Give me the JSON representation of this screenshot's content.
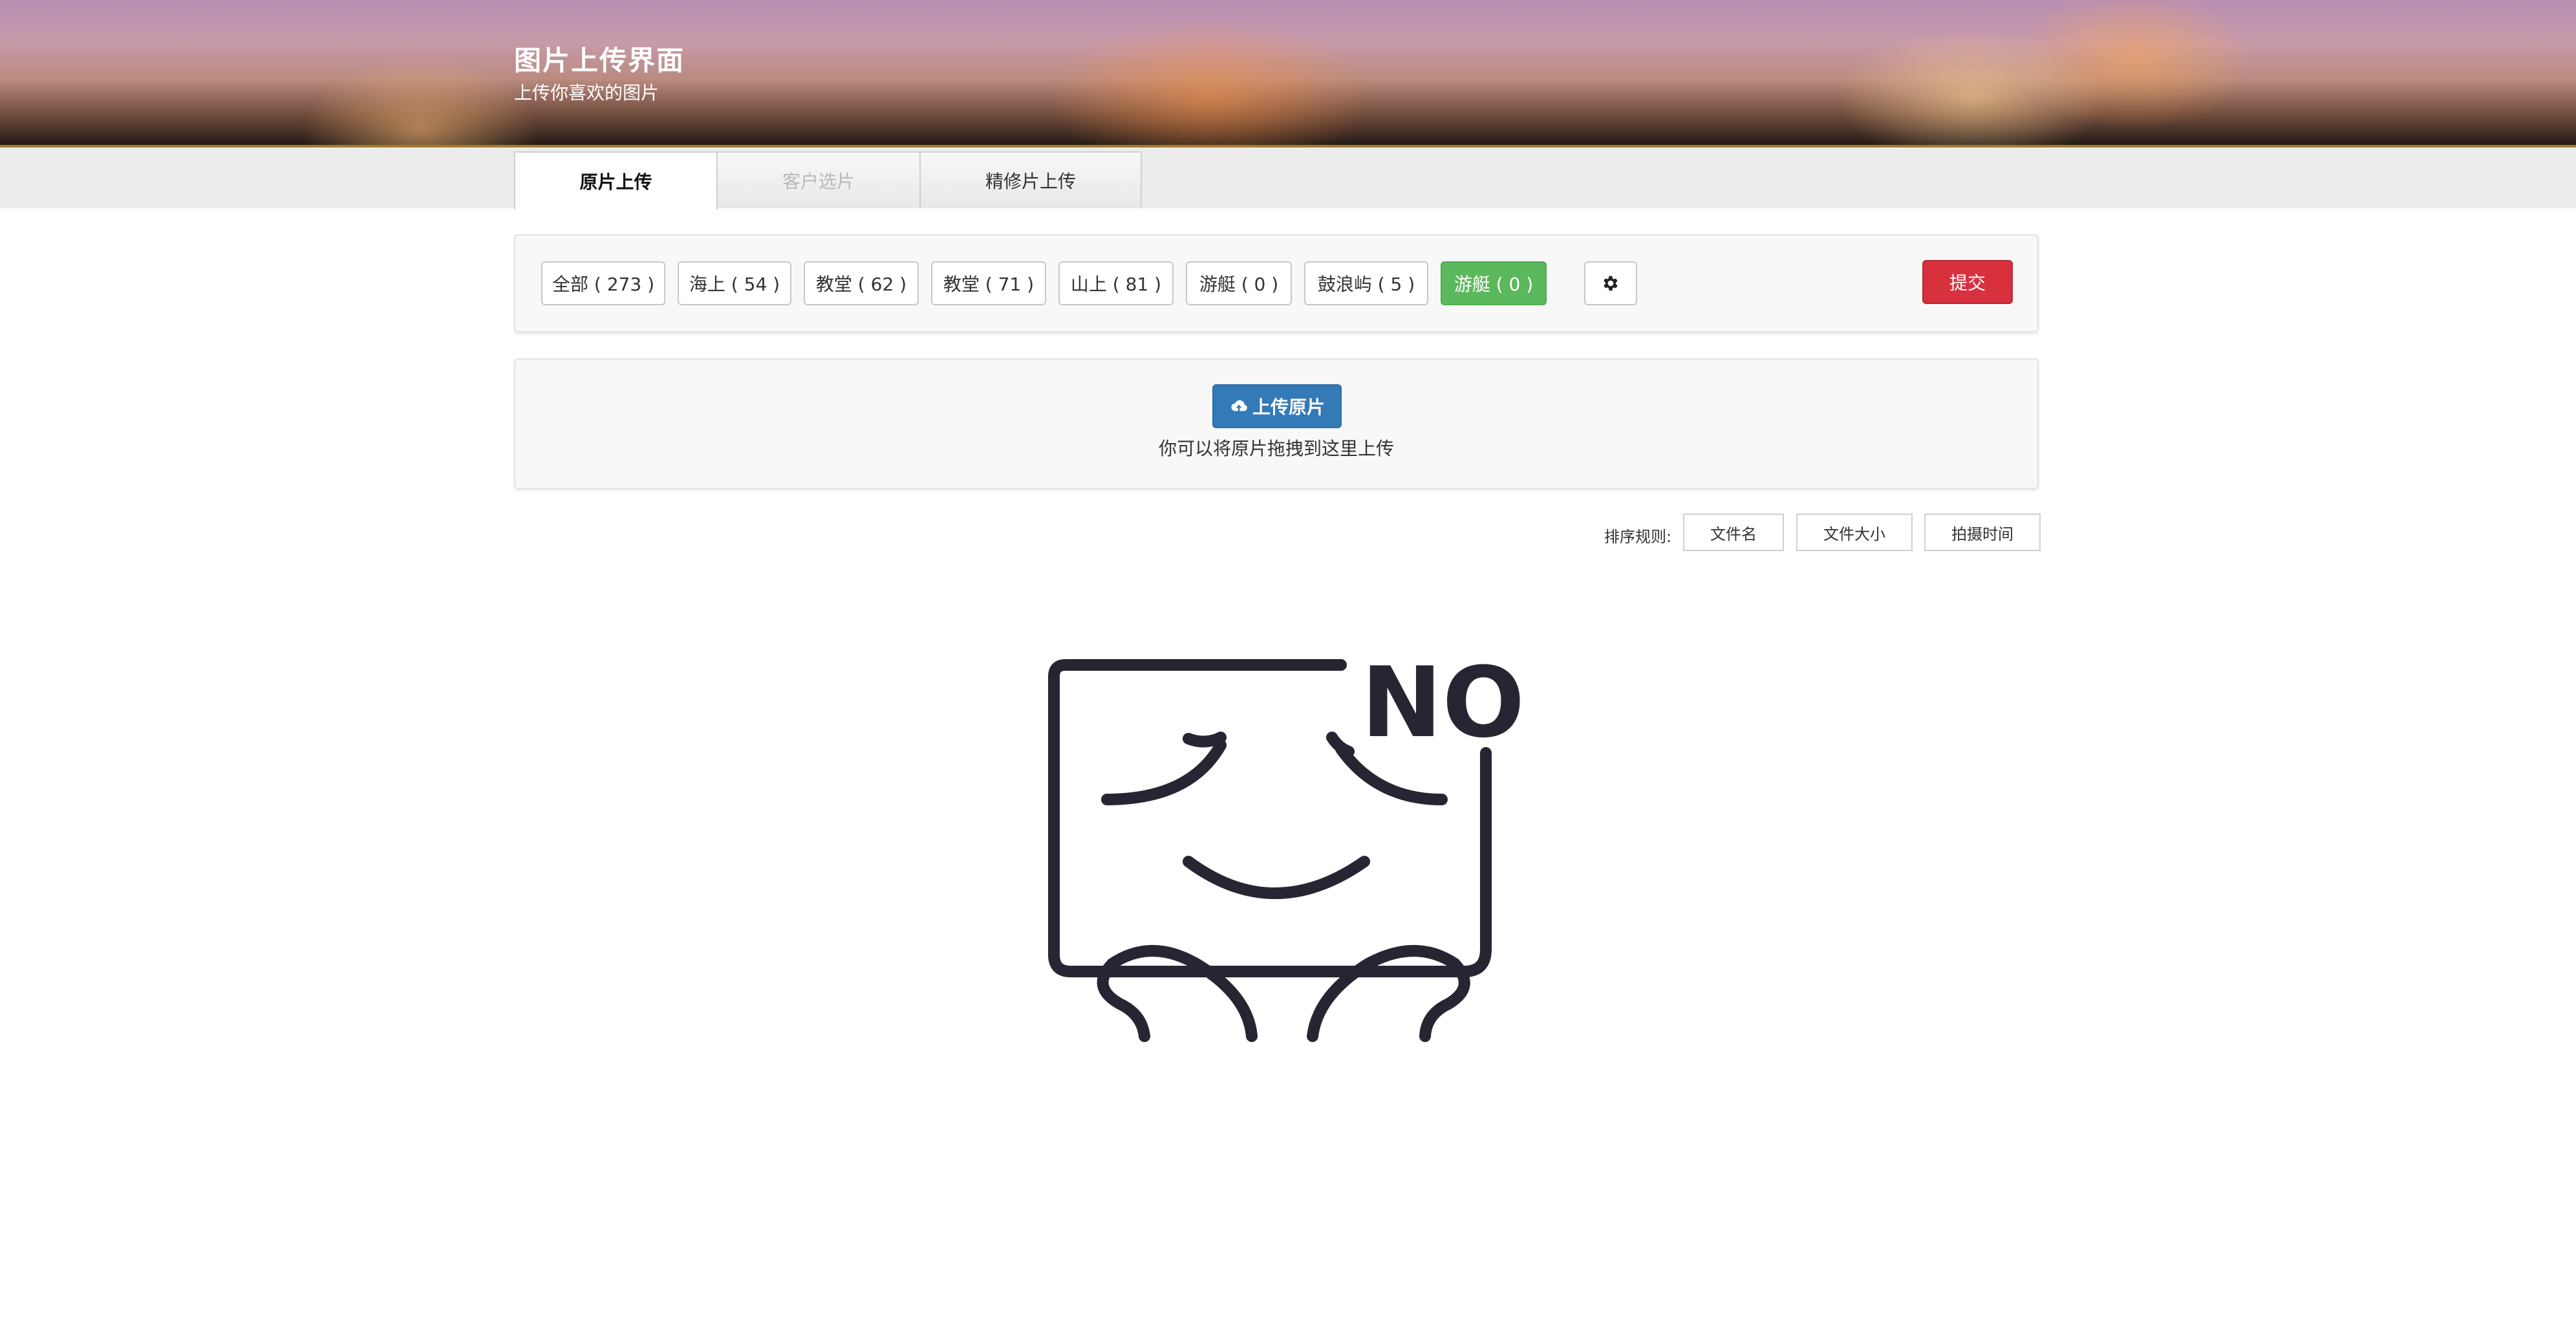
{
  "header": {
    "title": "图片上传界面",
    "subtitle": "上传你喜欢的图片"
  },
  "tabs": [
    {
      "label": "原片上传",
      "state": "active"
    },
    {
      "label": "客户选片",
      "state": "disabled"
    },
    {
      "label": "精修片上传",
      "state": "normal"
    }
  ],
  "filters": [
    {
      "label": "全部 ( 273 )"
    },
    {
      "label": "海上 ( 54 )"
    },
    {
      "label": "教堂 ( 62 )"
    },
    {
      "label": "教堂 ( 71 )"
    },
    {
      "label": "山上 ( 81 )"
    },
    {
      "label": "游艇 ( 0 )"
    },
    {
      "label": "鼓浪屿 ( 5 )"
    },
    {
      "label": "游艇 ( 0 )",
      "selected": true
    }
  ],
  "toolbar": {
    "settings_icon": "gear-icon",
    "submit_label": "提交"
  },
  "upload": {
    "button_label": "上传原片",
    "button_icon": "cloud-upload-icon",
    "hint": "你可以将原片拖拽到这里上传"
  },
  "sort": {
    "label": "排序规则:",
    "options": [
      "文件名",
      "文件大小",
      "拍摄时间"
    ]
  },
  "empty_state": {
    "text": "NO",
    "illustration": "sleeping-face-illustration"
  },
  "colors": {
    "selected_filter": "#5cb85c",
    "submit": "#d9303e",
    "upload": "#337ab7",
    "illustration": "#262633"
  }
}
